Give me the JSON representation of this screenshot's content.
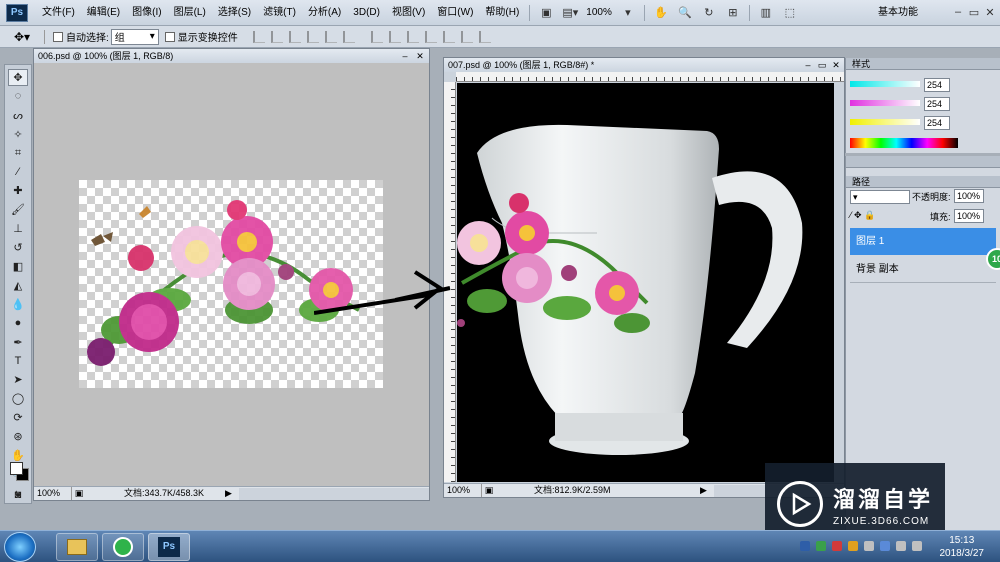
{
  "menubar": {
    "logo": "Ps",
    "items": [
      "文件(F)",
      "编辑(E)",
      "图像(I)",
      "图层(L)",
      "选择(S)",
      "滤镜(T)",
      "分析(A)",
      "3D(D)",
      "视图(V)",
      "窗口(W)",
      "帮助(H)"
    ],
    "zoom": "100%",
    "workspace": "基本功能"
  },
  "optbar": {
    "auto_select_label": "自动选择:",
    "auto_select_value": "组",
    "show_transform_label": "显示变换控件"
  },
  "doc_left": {
    "title": "006.psd @ 100% (图层 1, RGB/8)",
    "zoom": "100%",
    "info": "文档:343.7K/458.3K"
  },
  "doc_right": {
    "title": "007.psd @ 100% (图层 1, RGB/8#) *",
    "zoom": "100%",
    "info": "文档:812.9K/2.59M"
  },
  "color_panel": {
    "tab": "样式",
    "values": [
      "254",
      "254",
      "254"
    ]
  },
  "layers_panel": {
    "tab": "路径",
    "opacity_label": "不透明度:",
    "opacity_value": "100%",
    "fill_label": "填充:",
    "fill_value": "100%",
    "layers": [
      "图层 1",
      "背景 副本"
    ]
  },
  "badge": "10",
  "watermark": {
    "title": "溜溜自学",
    "subtitle": "ZIXUE.3D66.COM"
  },
  "taskbar": {
    "time": "15:13",
    "date": "2018/3/27",
    "ps_label": "Ps"
  },
  "colors": {
    "selected_layer": "#3a8ee6",
    "canvas_black": "#000000",
    "badge_green": "#2ea84a"
  }
}
